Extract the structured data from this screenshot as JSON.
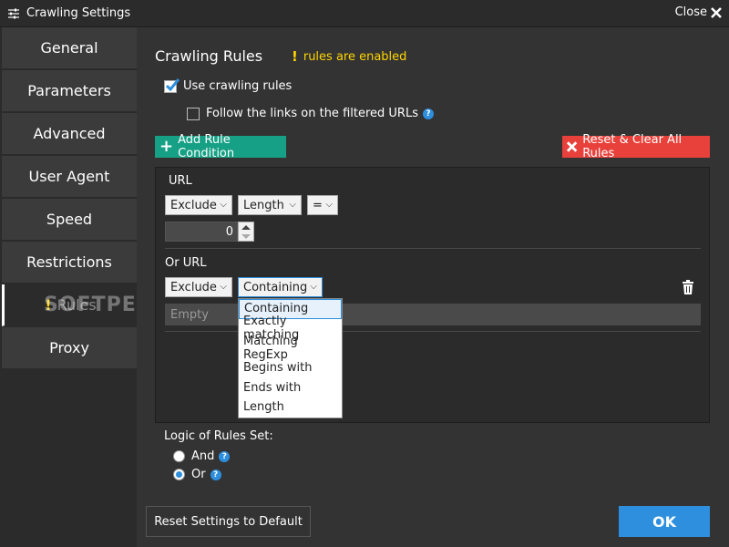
{
  "window": {
    "title": "Crawling Settings",
    "close_label": "Close"
  },
  "sidebar": {
    "items": [
      {
        "label": "General"
      },
      {
        "label": "Parameters"
      },
      {
        "label": "Advanced"
      },
      {
        "label": "User Agent"
      },
      {
        "label": "Speed"
      },
      {
        "label": "Restrictions"
      },
      {
        "label": "Rules",
        "warning": "!"
      },
      {
        "label": "Proxy"
      }
    ]
  },
  "watermark": "SOFTPEDIA",
  "main": {
    "heading": "Crawling Rules",
    "enabled_notice": "rules are enabled",
    "enabled_bang": "!",
    "use_rules_label": "Use crawling rules",
    "follow_links_label": "Follow the links on the filtered URLs",
    "help_glyph": "?",
    "add_rule_label": "Add Rule Condition",
    "add_rule_glyph": "+",
    "reset_rules_label": "Reset & Clear All Rules"
  },
  "rules": {
    "group1": {
      "label": "URL",
      "action": "Exclude",
      "field": "Length",
      "operator": "=",
      "value": "0"
    },
    "group2": {
      "label": "Or URL",
      "action": "Exclude",
      "match": "Containing",
      "empty_placeholder": "Empty"
    }
  },
  "dropdown": {
    "options": [
      "Containing",
      "Exactly matching",
      "Matching RegExp",
      "Begins with",
      "Ends with",
      "Length"
    ],
    "selected": "Containing"
  },
  "logic": {
    "label": "Logic of Rules Set:",
    "and_label": "And",
    "or_label": "Or",
    "selected": "Or"
  },
  "footer": {
    "reset_default_label": "Reset Settings to Default",
    "ok_label": "OK"
  },
  "colors": {
    "accent": "#2d8fde",
    "add_button": "#16a085",
    "reset_button": "#e8403a",
    "warning": "#ffd500"
  }
}
